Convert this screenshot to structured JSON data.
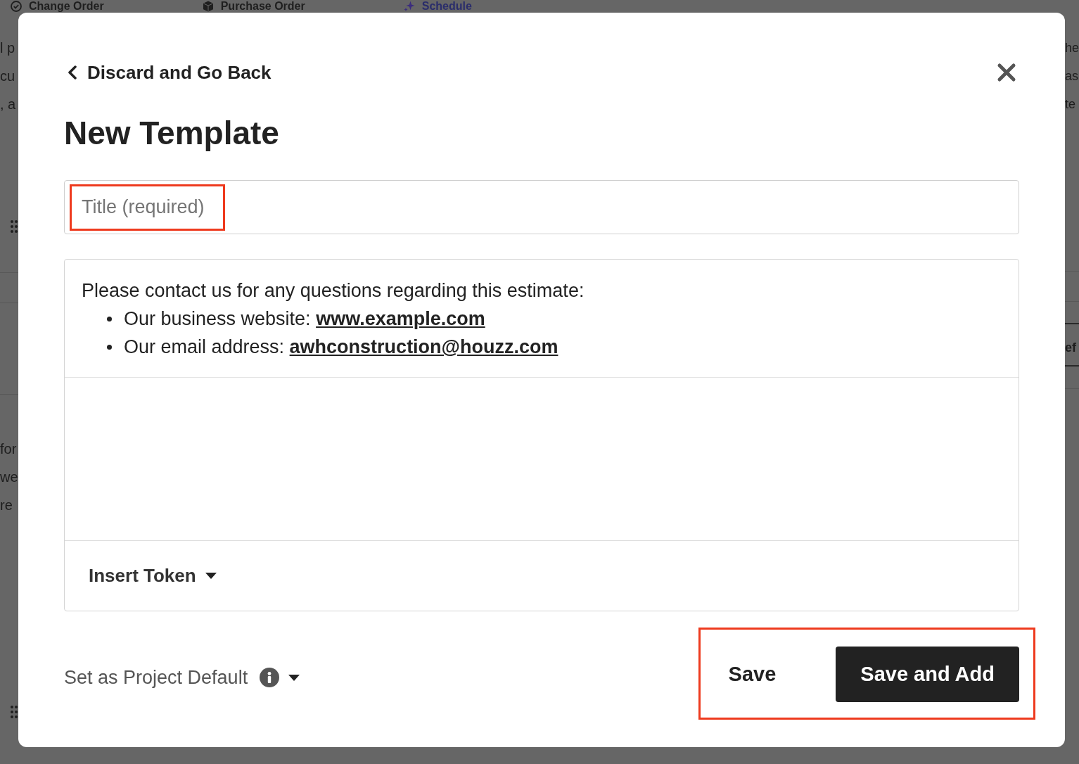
{
  "background_tabs": [
    {
      "label": "Change Order",
      "color": "#1f1f1f"
    },
    {
      "label": "Purchase Order",
      "color": "#1f1f1f"
    },
    {
      "label": "Schedule",
      "color": "#2a2d6b"
    }
  ],
  "left_edge": {
    "upper_lines": [
      "l p",
      "cu",
      ", a"
    ],
    "lower_lines": [
      "for",
      "we",
      "re"
    ]
  },
  "right_edge": {
    "lines": [
      "he",
      "as",
      "te"
    ],
    "heading": "ef"
  },
  "dialog": {
    "back_link": "Discard and Go Back",
    "title": "New Template",
    "title_field": {
      "placeholder": "Title (required)",
      "highlighted": true
    },
    "editor": {
      "intro": "Please contact us for any questions regarding this estimate:",
      "bullets": [
        {
          "label": "Our business website:",
          "link": "www.example.com"
        },
        {
          "label": "Our email address:",
          "link": "awhconstruction@houzz.com"
        }
      ],
      "insert_token": "Insert Token"
    },
    "project_default": "Set as Project Default",
    "actions": {
      "highlighted": true,
      "buttons": [
        {
          "label": "Save",
          "kind": "text"
        },
        {
          "label": "Save and Add",
          "kind": "primary"
        }
      ]
    }
  }
}
